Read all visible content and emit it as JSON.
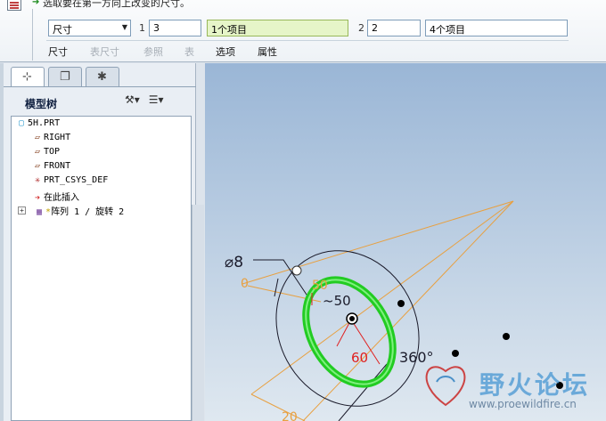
{
  "dashboard": {
    "message": "选取要在第一方向上改变的尺寸。",
    "dim_select": "尺寸",
    "dir1_label": "1",
    "dir1_count": "3",
    "dir1_items": "1个项目",
    "dir2_label": "2",
    "dir2_count": "2",
    "dir2_items": "4个项目",
    "tabs": [
      {
        "label": "尺寸",
        "enabled": true
      },
      {
        "label": "表尺寸",
        "enabled": false
      },
      {
        "label": "参照",
        "enabled": false
      },
      {
        "label": "表",
        "enabled": false
      },
      {
        "label": "选项",
        "enabled": true
      },
      {
        "label": "属性",
        "enabled": true
      }
    ]
  },
  "panel": {
    "title": "模型树",
    "tree": [
      {
        "label": "5H.PRT",
        "icon": "part-icon"
      },
      {
        "label": "RIGHT",
        "icon": "datum-plane-icon"
      },
      {
        "label": "TOP",
        "icon": "datum-plane-icon"
      },
      {
        "label": "FRONT",
        "icon": "datum-plane-icon"
      },
      {
        "label": "PRT_CSYS_DEF",
        "icon": "csys-icon"
      },
      {
        "label": "在此插入",
        "icon": "insert-arrow-icon"
      },
      {
        "label": "阵列 1 / 旋转 2",
        "icon": "pattern-icon"
      }
    ]
  },
  "graphics": {
    "dim_diameter": "⌀8",
    "dim_angle_small": "0",
    "dim_50": "50",
    "dim_50b": "~50",
    "dim_60": "60",
    "dim_360": "360°",
    "dim_bottom": "20"
  },
  "watermark": {
    "text": "野火论坛",
    "url": "www.proewildfire.cn"
  },
  "colors": {
    "ring": "#22cc22",
    "dimension_red": "#e02020",
    "orange_lines": "#e8a040",
    "viewport_top": "#9ab6d6"
  }
}
